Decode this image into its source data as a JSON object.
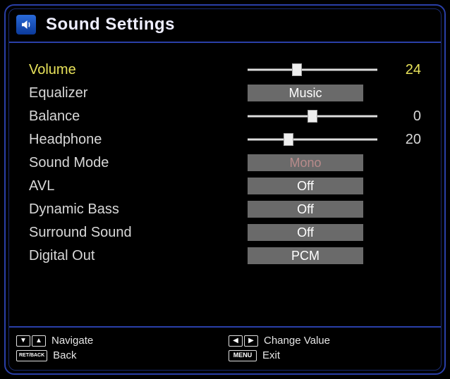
{
  "title": "Sound Settings",
  "rows": [
    {
      "label": "Volume",
      "type": "slider",
      "highlight": true,
      "value": 24,
      "min": 0,
      "max": 63,
      "display": "24"
    },
    {
      "label": "Equalizer",
      "type": "select",
      "value": "Music"
    },
    {
      "label": "Balance",
      "type": "slider",
      "value": 0,
      "min": -31,
      "max": 31,
      "display": "0"
    },
    {
      "label": "Headphone",
      "type": "slider",
      "value": 20,
      "min": 0,
      "max": 63,
      "display": "20"
    },
    {
      "label": "Sound Mode",
      "type": "select",
      "value": "Mono",
      "dim": true
    },
    {
      "label": "AVL",
      "type": "select",
      "value": "Off"
    },
    {
      "label": "Dynamic Bass",
      "type": "select",
      "value": "Off"
    },
    {
      "label": "Surround Sound",
      "type": "select",
      "value": "Off"
    },
    {
      "label": "Digital Out",
      "type": "select",
      "value": "PCM"
    }
  ],
  "footer": {
    "navigate": "Navigate",
    "change": "Change Value",
    "back": "Back",
    "exit": "Exit",
    "ret_key": "RET/BACK",
    "menu_key": "MENU"
  }
}
